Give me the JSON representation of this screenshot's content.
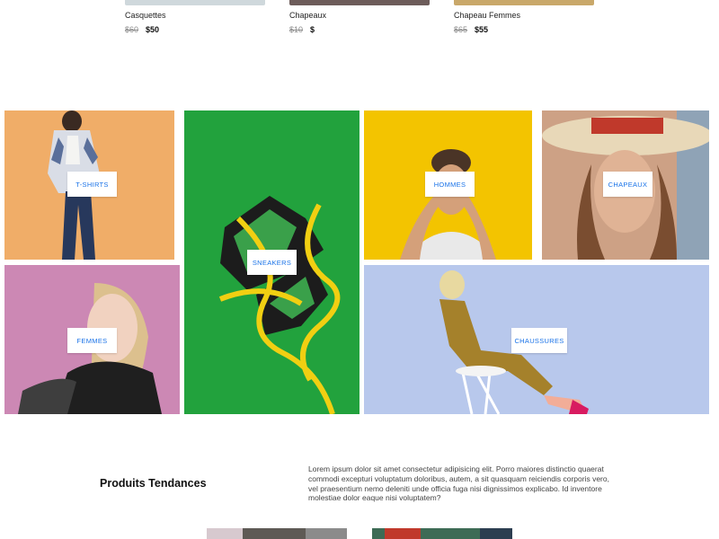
{
  "products": [
    {
      "name": "Casquettes",
      "old_price": "$60",
      "new_price": "$50",
      "thumb_color": "#cfd8dc"
    },
    {
      "name": "Chapeaux",
      "old_price": "$10",
      "new_price": "$",
      "thumb_color": "#6d5c5a"
    },
    {
      "name": "Chapeau Femmes",
      "old_price": "$65",
      "new_price": "$55",
      "thumb_color": "#c9a86a"
    }
  ],
  "categories": {
    "tshirts": "T-SHIRTS",
    "sneakers": "SNEAKERS",
    "hommes": "HOMMES",
    "chapeaux": "CHAPEAUX",
    "femmes": "FEMMES",
    "chaussures": "CHAUSSURES"
  },
  "trending": {
    "title": "Produits Tendances",
    "text": "Lorem ipsum dolor sit amet consectetur adipisicing elit. Porro maiores distinctio quaerat commodi excepturi voluptatum doloribus, autem, a sit quasquam reiciendis corporis vero, vel praesentium nemo deleniti unde officia fuga nisi dignissimos explicabo. Id inventore molestiae dolor eaque nisi voluptatem?"
  },
  "colors": {
    "label_text": "#1a73e8",
    "tshirts_bg": "#f2b06b",
    "sneakers_bg": "#1fa13a",
    "hommes_bg": "#f2c500",
    "chapeaux_bg": "#cfa58b",
    "femmes_bg": "#cf8ab5",
    "chaussures_bg": "#b9c8ea"
  }
}
